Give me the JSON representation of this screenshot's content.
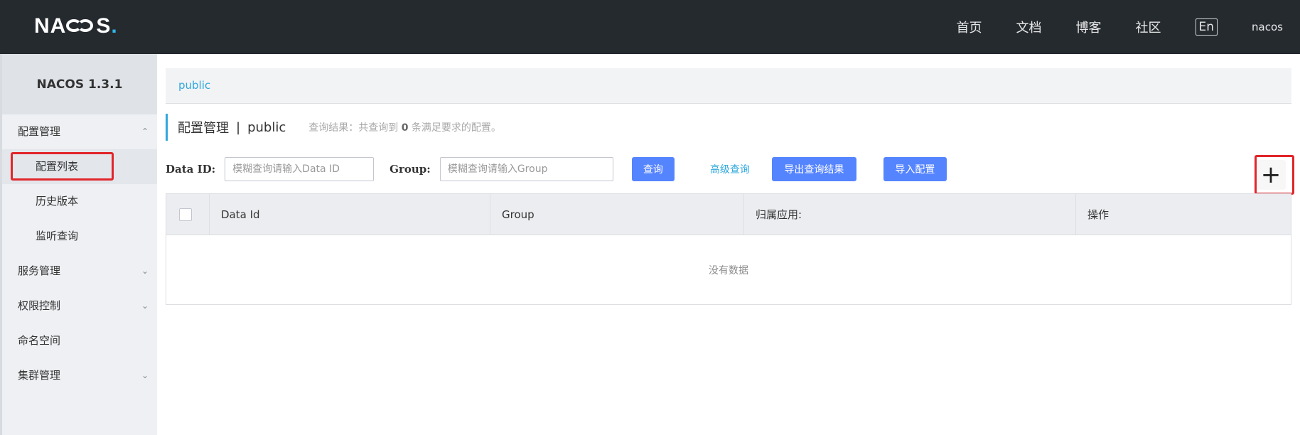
{
  "header": {
    "logo_left": "NA",
    "logo_right": "S",
    "logo_dot": ".",
    "nav": [
      "首页",
      "文档",
      "博客",
      "社区"
    ],
    "lang": "En",
    "user": "nacos"
  },
  "sidebar": {
    "version": "NACOS 1.3.1",
    "items": [
      {
        "label": "配置管理",
        "chevron": "^"
      },
      {
        "label": "配置列表"
      },
      {
        "label": "历史版本"
      },
      {
        "label": "监听查询"
      },
      {
        "label": "服务管理",
        "chevron": "v"
      },
      {
        "label": "权限控制",
        "chevron": "v"
      },
      {
        "label": "命名空间"
      },
      {
        "label": "集群管理",
        "chevron": "v"
      }
    ]
  },
  "main": {
    "breadcrumb": "public",
    "title": "配置管理",
    "title_sep": "|",
    "namespace": "public",
    "result_prefix": "查询结果：共查询到",
    "result_count": "0",
    "result_suffix": "条满足要求的配置。",
    "search": {
      "data_id_label": "Data ID:",
      "data_id_placeholder": "模糊查询请输入Data ID",
      "group_label": "Group:",
      "group_placeholder": "模糊查询请输入Group",
      "query_button": "查询",
      "advanced_query": "高级查询",
      "export_button": "导出查询结果",
      "import_button": "导入配置",
      "add_button": "+"
    },
    "table": {
      "columns": [
        "Data Id",
        "Group",
        "归属应用:",
        "操作"
      ],
      "empty_text": "没有数据"
    }
  },
  "colors": {
    "topbar": "#252a2f",
    "accent": "#2fa8dd",
    "primary_button": "#5584ff",
    "highlight": "#e1252a"
  }
}
